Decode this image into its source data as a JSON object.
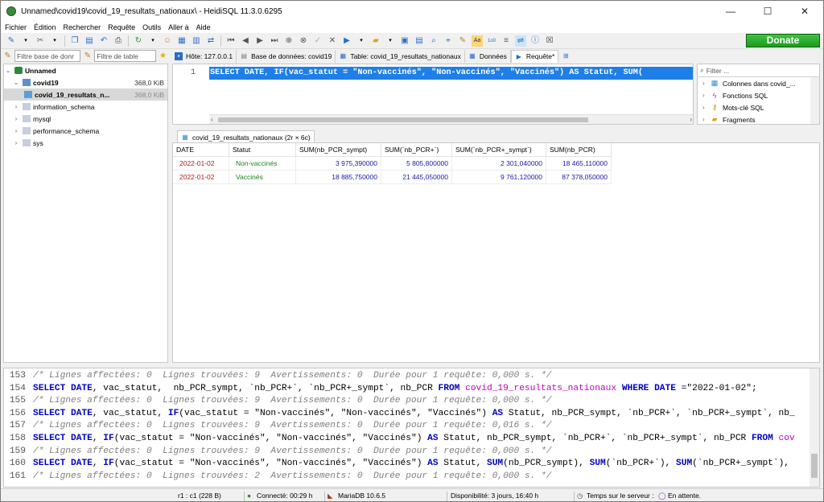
{
  "window": {
    "title": "Unnamed\\covid19\\covid_19_resultats_nationaux\\ - HeidiSQL 11.3.0.6295",
    "minimize": "—",
    "maximize": "☐",
    "close": "✕"
  },
  "menu": [
    "Fichier",
    "Édition",
    "Rechercher",
    "Requête",
    "Outils",
    "Aller à",
    "Aide"
  ],
  "toolbar": {
    "donate_label": "Donate"
  },
  "filters": {
    "db_filter": "Filtre base de donr",
    "table_filter": "Filtre de table"
  },
  "tabs": [
    {
      "label": "Hôte: 127.0.0.1",
      "icon": "host-icon"
    },
    {
      "label": "Base de données: covid19",
      "icon": "database-icon"
    },
    {
      "label": "Table: covid_19_resultats_nationaux",
      "icon": "table-icon"
    },
    {
      "label": "Données",
      "icon": "grid-icon"
    },
    {
      "label": "Requête*",
      "icon": "play-icon"
    }
  ],
  "tree": {
    "root": "Unnamed",
    "items": [
      {
        "label": "covid19",
        "size": "368,0 KiB"
      },
      {
        "label": "covid_19_resultats_n...",
        "size": "368,0 KiB"
      },
      {
        "label": "information_schema",
        "size": ""
      },
      {
        "label": "mysql",
        "size": ""
      },
      {
        "label": "performance_schema",
        "size": ""
      },
      {
        "label": "sys",
        "size": ""
      }
    ]
  },
  "editor": {
    "line_number": "1",
    "sql": "SELECT DATE, IF(vac_statut = \"Non-vaccinés\", \"Non-vaccinés\", \"Vaccinés\") AS Statut, SUM("
  },
  "helper": {
    "filter_placeholder": "Filter ...",
    "items": [
      "Colonnes dans covid_...",
      "Fonctions SQL",
      "Mots-clé SQL",
      "Fragments"
    ]
  },
  "results": {
    "tab_label": "covid_19_resultats_nationaux (2r × 6c)",
    "columns": [
      "DATE",
      "Statut",
      "SUM(nb_PCR_sympt)",
      "SUM(`nb_PCR+`)",
      "SUM(`nb_PCR+_sympt`)",
      "SUM(nb_PCR)"
    ],
    "rows": [
      [
        "2022-01-02",
        "Non-vaccinés",
        "3 975,390000",
        "5 805,800000",
        "2 301,040000",
        "18 465,110000"
      ],
      [
        "2022-01-02",
        "Vaccinés",
        "18 885,750000",
        "21 445,050000",
        "9 761,120000",
        "87 378,050000"
      ]
    ]
  },
  "log": [
    {
      "n": "153",
      "parts": [
        [
          "cmt",
          "/* Lignes affectées: 0  Lignes trouvées: 9  Avertissements: 0  Durée pour 1 requête: 0,000 s. */"
        ]
      ]
    },
    {
      "n": "154",
      "parts": [
        [
          "kw",
          "SELECT DATE"
        ],
        [
          "id",
          ", vac_statut,  nb_PCR_sympt, `nb_PCR+`, `nb_PCR+_sympt`, nb_PCR "
        ],
        [
          "kw",
          "FROM "
        ],
        [
          "tbl",
          "covid_19_resultats_nationaux "
        ],
        [
          "kw",
          "WHERE DATE "
        ],
        [
          "id",
          "=\"2022-01-02\";"
        ]
      ]
    },
    {
      "n": "155",
      "parts": [
        [
          "cmt",
          "/* Lignes affectées: 0  Lignes trouvées: 9  Avertissements: 0  Durée pour 1 requête: 0,000 s. */"
        ]
      ]
    },
    {
      "n": "156",
      "parts": [
        [
          "kw",
          "SELECT DATE"
        ],
        [
          "id",
          ", vac_statut, "
        ],
        [
          "kw",
          "IF"
        ],
        [
          "id",
          "(vac_statut = \"Non-vaccinés\", \"Non-vaccinés\", \"Vaccinés\") "
        ],
        [
          "kw",
          "AS "
        ],
        [
          "id",
          "Statut, nb_PCR_sympt, `nb_PCR+`, `nb_PCR+_sympt`, nb_"
        ]
      ]
    },
    {
      "n": "157",
      "parts": [
        [
          "cmt",
          "/* Lignes affectées: 0  Lignes trouvées: 9  Avertissements: 0  Durée pour 1 requête: 0,016 s. */"
        ]
      ]
    },
    {
      "n": "158",
      "parts": [
        [
          "kw",
          "SELECT DATE"
        ],
        [
          "id",
          ", "
        ],
        [
          "kw",
          "IF"
        ],
        [
          "id",
          "(vac_statut = \"Non-vaccinés\", \"Non-vaccinés\", \"Vaccinés\") "
        ],
        [
          "kw",
          "AS "
        ],
        [
          "id",
          "Statut, nb_PCR_sympt, `nb_PCR+`, `nb_PCR+_sympt`, nb_PCR "
        ],
        [
          "kw",
          "FROM "
        ],
        [
          "tbl",
          "cov"
        ]
      ]
    },
    {
      "n": "159",
      "parts": [
        [
          "cmt",
          "/* Lignes affectées: 0  Lignes trouvées: 9  Avertissements: 0  Durée pour 1 requête: 0,000 s. */"
        ]
      ]
    },
    {
      "n": "160",
      "parts": [
        [
          "kw",
          "SELECT DATE"
        ],
        [
          "id",
          ", "
        ],
        [
          "kw",
          "IF"
        ],
        [
          "id",
          "(vac_statut = \"Non-vaccinés\", \"Non-vaccinés\", \"Vaccinés\") "
        ],
        [
          "kw",
          "AS "
        ],
        [
          "id",
          "Statut, "
        ],
        [
          "kw",
          "SUM"
        ],
        [
          "id",
          "(nb_PCR_sympt), "
        ],
        [
          "kw",
          "SUM"
        ],
        [
          "id",
          "(`nb_PCR+`), "
        ],
        [
          "kw",
          "SUM"
        ],
        [
          "id",
          "(`nb_PCR+_sympt`),"
        ]
      ]
    },
    {
      "n": "161",
      "parts": [
        [
          "cmt",
          "/* Lignes affectées: 0  Lignes trouvées: 2  Avertissements: 0  Durée pour 1 requête: 0,000 s. */"
        ]
      ]
    }
  ],
  "status": {
    "position": "r1 : c1 (228 B)",
    "connected": "Connecté: 00:29 h",
    "server": "MariaDB 10.6.5",
    "uptime": "Disponibilité: 3 jours, 16:40 h",
    "server_time": "Temps sur le serveur :",
    "state": "En attente."
  }
}
